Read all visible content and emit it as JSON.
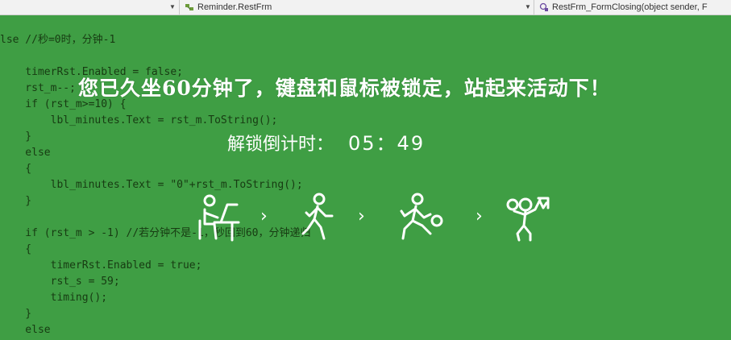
{
  "toolbar": {
    "left_dropdown_value": "",
    "class_dropdown": "Reminder.RestFrm",
    "member_dropdown": "RestFrm_FormClosing(object sender, F"
  },
  "code": {
    "lines": [
      "lse //秒=0时，分钟-1",
      "",
      "    timerRst.Enabled = false;",
      "    rst_m--;",
      "    if (rst_m>=10) {",
      "        lbl_minutes.Text = rst_m.ToString();",
      "    }",
      "    else",
      "    {",
      "        lbl_minutes.Text = \"0\"+rst_m.ToString();",
      "    }",
      "",
      "    if (rst_m > -1) //若分钟不是-1，秒回到60，分钟递归",
      "    {",
      "        timerRst.Enabled = true;",
      "        rst_s = 59;",
      "        timing();",
      "    }",
      "    else"
    ]
  },
  "overlay": {
    "message": "您已久坐60分钟了，键盘和鼠标被锁定，站起来活动下！",
    "countdown_label": "解锁倒计时：",
    "countdown_time": "05：49"
  },
  "icons": {
    "steps": [
      "person-at-desk-icon",
      "walking-person-icon",
      "ball-kicking-person-icon",
      "basketball-player-icon"
    ],
    "separator": "›"
  },
  "colors": {
    "overlay_background": "#3f9e44",
    "overlay_text": "#ffffff"
  }
}
